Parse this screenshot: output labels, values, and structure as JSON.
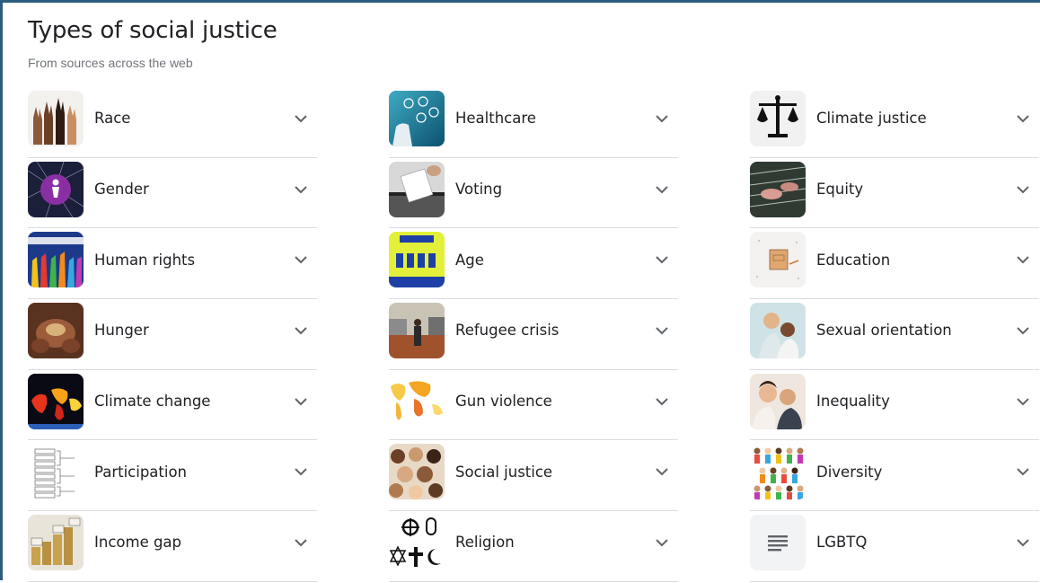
{
  "header": {
    "title": "Types of social justice",
    "subtitle": "From sources across the web"
  },
  "columns": [
    {
      "items": [
        {
          "label": "Race",
          "icon": "raised-hands-image"
        },
        {
          "label": "Gender",
          "icon": "gender-network-image"
        },
        {
          "label": "Human rights",
          "icon": "raised-colorful-hands-image"
        },
        {
          "label": "Hunger",
          "icon": "hands-holding-grain-image"
        },
        {
          "label": "Climate change",
          "icon": "heat-map-world-image"
        },
        {
          "label": "Participation",
          "icon": "ladder-diagram-image"
        },
        {
          "label": "Income gap",
          "icon": "income-coins-image"
        }
      ]
    },
    {
      "items": [
        {
          "label": "Healthcare",
          "icon": "medical-icons-image"
        },
        {
          "label": "Voting",
          "icon": "ballot-box-image"
        },
        {
          "label": "Age",
          "icon": "ageism-poster-image"
        },
        {
          "label": "Refugee crisis",
          "icon": "refugee-camp-image"
        },
        {
          "label": "Gun violence",
          "icon": "world-map-image"
        },
        {
          "label": "Social justice",
          "icon": "crowd-faces-image"
        },
        {
          "label": "Religion",
          "icon": "religious-symbols-image"
        }
      ]
    },
    {
      "items": [
        {
          "label": "Climate justice",
          "icon": "scales-of-justice-icon"
        },
        {
          "label": "Equity",
          "icon": "livestock-pens-image"
        },
        {
          "label": "Education",
          "icon": "book-illustration-image"
        },
        {
          "label": "Sexual orientation",
          "icon": "couple-photo-image"
        },
        {
          "label": "Inequality",
          "icon": "family-photo-image"
        },
        {
          "label": "Diversity",
          "icon": "diverse-people-image"
        },
        {
          "label": "LGBTQ",
          "icon": "text-lines-icon"
        }
      ]
    }
  ],
  "colors": {
    "frame": "#2c5d7c",
    "divider": "#dadce0",
    "text": "#202124",
    "subtext": "#70757a"
  }
}
